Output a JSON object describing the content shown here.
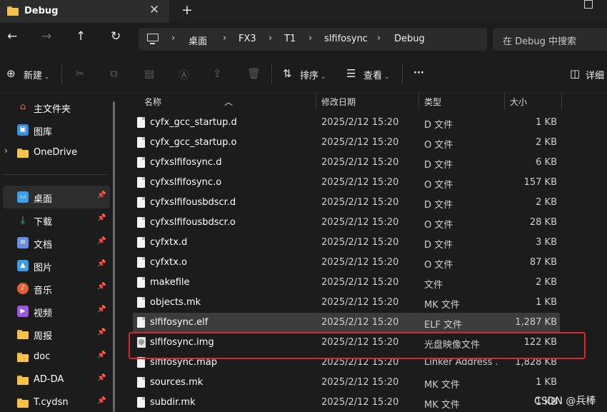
{
  "window": {
    "tab_title": "Debug",
    "tab_close": "✕",
    "new_tab": "+"
  },
  "nav": {
    "back": "←",
    "forward": "→",
    "up": "↑",
    "refresh": "↻"
  },
  "breadcrumb": [
    "桌面",
    "FX3",
    "T1",
    "slfifosync",
    "Debug"
  ],
  "breadcrumb_sep": "›",
  "search": {
    "placeholder": "在 Debug 中搜索"
  },
  "toolbar": {
    "new_label": "新建",
    "sort_label": "排序",
    "view_label": "查看",
    "more_label": "···",
    "details_label": "详细"
  },
  "sidebar": {
    "items": [
      {
        "label": "主文件夹",
        "icon": "home-icon",
        "color": "#e06a3a"
      },
      {
        "label": "图库",
        "icon": "gallery-icon",
        "color": "#3a8ee0"
      },
      {
        "label": "OneDrive",
        "icon": "folder-icon",
        "color": "#f7c24a"
      },
      {
        "label": "桌面",
        "icon": "desktop-icon",
        "color": "#3aa0e8"
      },
      {
        "label": "下载",
        "icon": "download-icon",
        "color": "#3ac0a0"
      },
      {
        "label": "文档",
        "icon": "document-icon",
        "color": "#6a8ee0"
      },
      {
        "label": "图片",
        "icon": "picture-icon",
        "color": "#3a9ee0"
      },
      {
        "label": "音乐",
        "icon": "music-icon",
        "color": "#e0603a"
      },
      {
        "label": "视频",
        "icon": "video-icon",
        "color": "#9a5ae0"
      },
      {
        "label": "周报",
        "icon": "folder-icon",
        "color": "#f7c24a"
      },
      {
        "label": "doc",
        "icon": "folder-icon",
        "color": "#f7c24a"
      },
      {
        "label": "AD-DA",
        "icon": "folder-icon",
        "color": "#f7c24a"
      },
      {
        "label": "T.cydsn",
        "icon": "folder-icon",
        "color": "#f7c24a"
      }
    ]
  },
  "columns": {
    "name": "名称",
    "date": "修改日期",
    "type": "类型",
    "size": "大小"
  },
  "files": [
    {
      "name": "cyfx_gcc_startup.d",
      "date": "2025/2/12 15:20",
      "type": "D 文件",
      "size": "1 KB"
    },
    {
      "name": "cyfx_gcc_startup.o",
      "date": "2025/2/12 15:20",
      "type": "O 文件",
      "size": "2 KB"
    },
    {
      "name": "cyfxslfifosync.d",
      "date": "2025/2/12 15:20",
      "type": "D 文件",
      "size": "6 KB"
    },
    {
      "name": "cyfxslfifosync.o",
      "date": "2025/2/12 15:20",
      "type": "O 文件",
      "size": "157 KB"
    },
    {
      "name": "cyfxslfifousbdscr.d",
      "date": "2025/2/12 15:20",
      "type": "D 文件",
      "size": "2 KB"
    },
    {
      "name": "cyfxslfifousbdscr.o",
      "date": "2025/2/12 15:20",
      "type": "O 文件",
      "size": "28 KB"
    },
    {
      "name": "cyfxtx.d",
      "date": "2025/2/12 15:20",
      "type": "D 文件",
      "size": "3 KB"
    },
    {
      "name": "cyfxtx.o",
      "date": "2025/2/12 15:20",
      "type": "O 文件",
      "size": "87 KB"
    },
    {
      "name": "makefile",
      "date": "2025/2/12 15:20",
      "type": "文件",
      "size": "2 KB"
    },
    {
      "name": "objects.mk",
      "date": "2025/2/12 15:20",
      "type": "MK 文件",
      "size": "1 KB"
    },
    {
      "name": "slfifosync.elf",
      "date": "2025/2/12 15:20",
      "type": "ELF 文件",
      "size": "1,287 KB"
    },
    {
      "name": "slfifosync.img",
      "date": "2025/2/12 15:20",
      "type": "光盘映像文件",
      "size": "122 KB"
    },
    {
      "name": "slfifosync.map",
      "date": "2025/2/12 15:20",
      "type": "Linker Address ...",
      "size": "1,828 KB"
    },
    {
      "name": "sources.mk",
      "date": "2025/2/12 15:20",
      "type": "MK 文件",
      "size": "1 KB"
    },
    {
      "name": "subdir.mk",
      "date": "2025/2/12 15:20",
      "type": "MK 文件",
      "size": "1 KB"
    }
  ],
  "watermark": "CSDN @兵棒",
  "colors": {
    "highlight": "#e0272b",
    "selected_row": "#3c3c3c"
  }
}
